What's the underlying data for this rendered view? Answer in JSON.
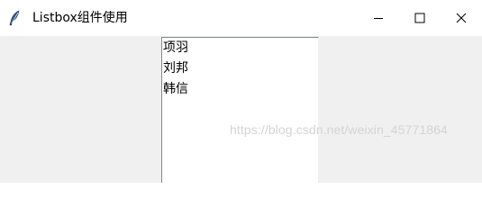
{
  "window": {
    "title": "Listbox组件使用",
    "icon": "feather-icon",
    "controls": {
      "minimize_icon": "minimize-icon",
      "maximize_icon": "maximize-icon",
      "close_icon": "close-icon"
    }
  },
  "listbox": {
    "items": [
      "项羽",
      "刘邦",
      "韩信"
    ]
  },
  "watermark": {
    "text": "https://blog.csdn.net/weixin_45771864"
  }
}
